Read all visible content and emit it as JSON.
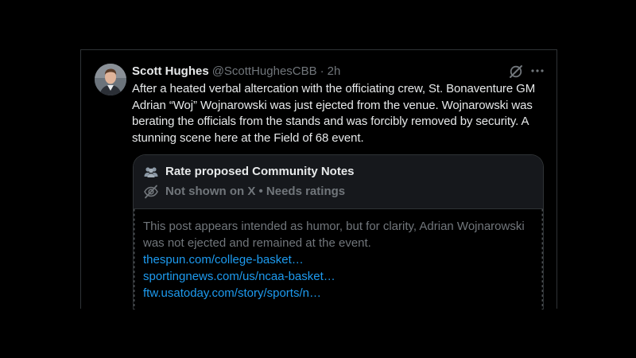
{
  "post": {
    "author": {
      "display_name": "Scott Hughes",
      "handle": "@ScottHughesCBB",
      "separator": "·",
      "time": "2h"
    },
    "text": "After a heated verbal altercation with the officiating crew, St. Bonaventure GM Adrian “Woj” Wojnarowski was just ejected from the venue. Wojnarowski was berating the officials from the stands and was forcibly removed by security. A stunning scene here at the Field of 68 event.",
    "icons": {
      "grok": "grok-icon",
      "more": "more-icon"
    }
  },
  "community_note": {
    "title": "Rate proposed Community Notes",
    "status": "Not shown on X • Needs ratings",
    "title_icon": "people-icon",
    "status_icon": "eye-off-icon",
    "text": "This post appears intended as humor, but for clarity, Adrian Wojnarowski was not ejected and remained at the event.",
    "links": [
      "thespun.com/college-basket…",
      "sportingnews.com/us/ncaa-basket…",
      "ftw.usatoday.com/story/sports/n…"
    ]
  },
  "colors": {
    "background": "#000000",
    "text_primary": "#e7e9ea",
    "text_secondary": "#71767b",
    "link": "#1d9bf0",
    "border": "#2f3336",
    "note_header_bg": "#16181c"
  }
}
